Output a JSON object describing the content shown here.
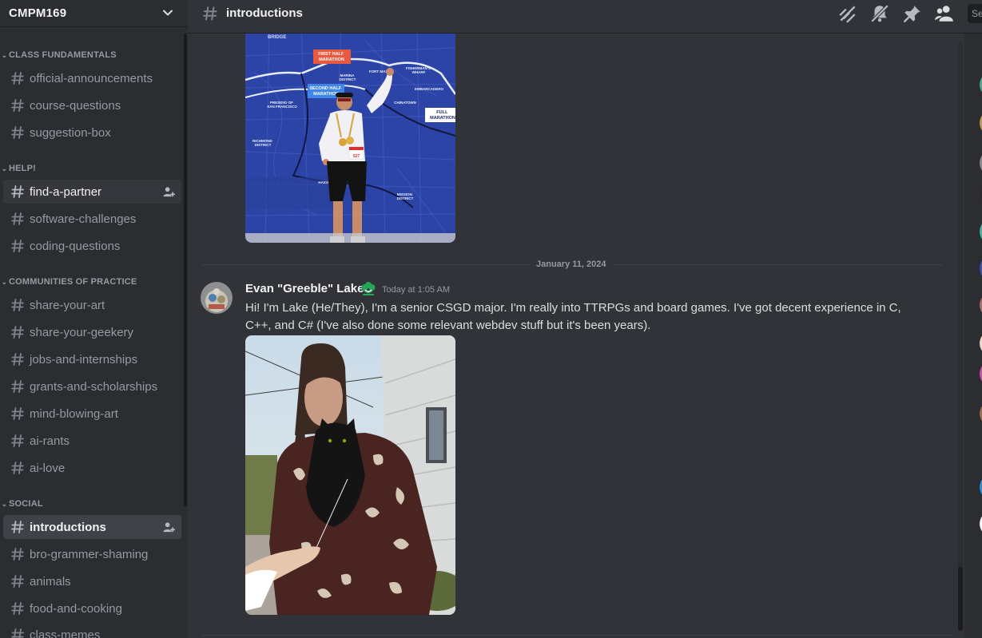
{
  "server": {
    "name": "CMPM169"
  },
  "categories": [
    {
      "name": "CLASS FUNDAMENTALS"
    },
    {
      "name": "HELP!"
    },
    {
      "name": "COMMUNITIES OF PRACTICE"
    },
    {
      "name": "SOCIAL"
    }
  ],
  "channels": [
    {
      "name": "official-announcements"
    },
    {
      "name": "course-questions"
    },
    {
      "name": "suggestion-box"
    },
    {
      "name": "find-a-partner"
    },
    {
      "name": "software-challenges"
    },
    {
      "name": "coding-questions"
    },
    {
      "name": "share-your-art"
    },
    {
      "name": "share-your-geekery"
    },
    {
      "name": "jobs-and-internships"
    },
    {
      "name": "grants-and-scholarships"
    },
    {
      "name": "mind-blowing-art"
    },
    {
      "name": "ai-rants"
    },
    {
      "name": "ai-love"
    },
    {
      "name": "introductions"
    },
    {
      "name": "bro-grammer-shaming"
    },
    {
      "name": "animals"
    },
    {
      "name": "food-and-cooking"
    },
    {
      "name": "class-memes"
    }
  ],
  "topbar": {
    "channel": "introductions",
    "icons": [
      "threads-icon",
      "mute-bell-icon",
      "pin-icon",
      "members-icon"
    ],
    "search_placeholder": "Se"
  },
  "poster_text": {
    "bridge": "BRIDGE",
    "first_half": "FIRST HALF\nMARATHON",
    "second_half": "SECOND HALF\nMARATHON",
    "full": "FULL\nMARATHON",
    "marina": "MARINA\nDISTRICT",
    "fort_mason": "FORT MASON",
    "fishermans": "FISHERMAN'S\nWHARF",
    "embarcadero": "EMBARCADERO",
    "chinatown": "CHINATOWN",
    "presidio": "PRESIDIO OF\nSAN FRANCISCO",
    "richmond": "RICHMOND\nDISTRICT",
    "haight": "HAIGHT",
    "mission": "MISSION\nDISTRICT",
    "bib": "527"
  },
  "date_divider": "January 11, 2024",
  "message": {
    "author": "Evan \"Greeble\" Lake",
    "timestamp": "Today at 1:05 AM",
    "text": "Hi! I'm Lake (He/They), I'm a senior CSGD major. I'm really into TTRPGs and board games. I've got decent experience in C, C++, and C# (I've also done some relevant webdev stuff but it's been years)."
  },
  "colors": {
    "sidebar": "#2b2d31",
    "chat": "#313338",
    "selected": "#404249",
    "muted": "#949ba4",
    "badge": "#23a55a"
  }
}
